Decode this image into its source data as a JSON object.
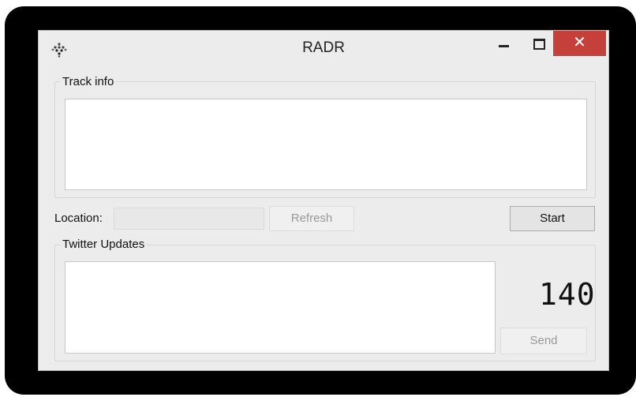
{
  "window": {
    "title": "RADR",
    "close_label": "✕"
  },
  "track_info": {
    "group_label": "Track info",
    "text": ""
  },
  "location": {
    "label": "Location:",
    "value": "",
    "refresh_label": "Refresh",
    "start_label": "Start"
  },
  "twitter": {
    "group_label": "Twitter Updates",
    "text": "",
    "char_counter": "140",
    "send_label": "Send"
  },
  "colors": {
    "close_button": "#c5403a",
    "window_bg": "#ececec"
  },
  "icons": {
    "app": "app-icon-diamond-dots",
    "minimize": "minimize-icon",
    "maximize": "maximize-icon",
    "close": "close-icon"
  }
}
